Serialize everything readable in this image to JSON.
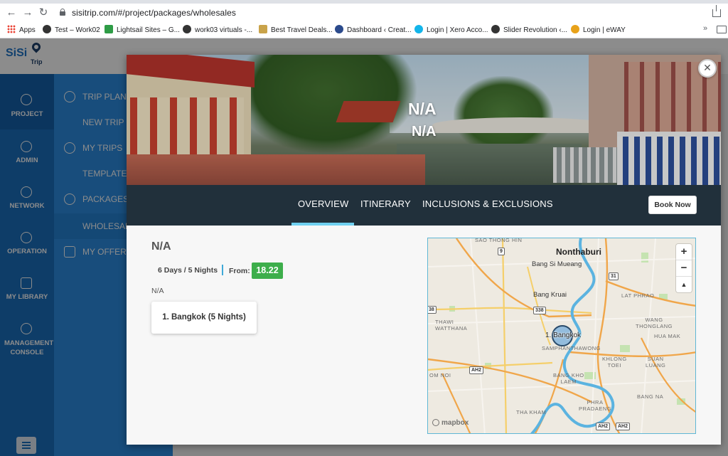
{
  "browser": {
    "url": "sisitrip.com/#/project/packages/wholesales",
    "bookmarks": [
      {
        "label": "Apps"
      },
      {
        "label": "Test – Work02"
      },
      {
        "label": "Lightsail Sites – G..."
      },
      {
        "label": "work03 virtuals -..."
      },
      {
        "label": "Best Travel Deals..."
      },
      {
        "label": "Dashboard ‹ Creat..."
      },
      {
        "label": "Login | Xero Acco..."
      },
      {
        "label": "Slider Revolution ‹..."
      },
      {
        "label": "Login | eWAY"
      }
    ],
    "more": "»"
  },
  "app": {
    "logo": "SiSi",
    "logo_sub": "Trip",
    "nav": [
      {
        "label": "PROJECT",
        "icon": "layers-icon"
      },
      {
        "label": "ADMIN",
        "icon": "user-icon"
      },
      {
        "label": "NETWORK",
        "icon": "globe-icon"
      },
      {
        "label": "OPERATION",
        "icon": "grid-icon"
      },
      {
        "label": "MY LIBRARY",
        "icon": "book-icon"
      },
      {
        "label": "MANAGEMENT CONSOLE",
        "icon": "sliders-icon"
      }
    ],
    "subnav": [
      {
        "label": "TRIP PLAN"
      },
      {
        "label": "NEW TRIP"
      },
      {
        "label": "MY TRIPS"
      },
      {
        "label": "TEMPLATE"
      },
      {
        "label": "PACKAGES"
      },
      {
        "label": "WHOLESAL"
      },
      {
        "label": "MY OFFERS"
      }
    ]
  },
  "modal": {
    "title": "N/A",
    "subtitle": "N/A",
    "tabs": [
      "OVERVIEW",
      "ITINERARY",
      "INCLUSIONS & EXCLUSIONS"
    ],
    "active_tab": "OVERVIEW",
    "book_now": "Book Now",
    "package": {
      "name": "N/A",
      "duration": "6 Days / 5 Nights",
      "from_label": "From:",
      "price": "18.22",
      "description": "N/A",
      "destinations": [
        "1. Bangkok (5 Nights)"
      ]
    },
    "map": {
      "labels": {
        "sao_thong_hin": "SAO THONG HIN",
        "nonthaburi": "Nonthaburi",
        "bang_si_mueang": "Bang Si Mueang",
        "bang_kruai": "Bang Kruai",
        "lat_phrao": "LAT PHRAO",
        "thawi_watthana": "THAWI\nWATTHANA",
        "wang_thonglang": "WANG\nTHONGLANG",
        "huai_khwang": "HUA MAK",
        "samphanthawong": "SAMPHANTHAWONG",
        "khlong_toei": "KHLONG\nTOEI",
        "suan_luang": "SUAN\nLUANG",
        "nong_khaem": "OM NOI",
        "bang_kho_laem": "BANG KHO\nLAEM",
        "bang_na": "BANG NA",
        "phra_pradaeng": "PHRA\nPRADAENG",
        "tha_kham": "THA KHAM"
      },
      "shields": [
        "9",
        "31",
        "338",
        "38",
        "AH2",
        "AH2",
        "AH2"
      ],
      "marker_label": "1. Bangkok",
      "zoom_in": "+",
      "zoom_out": "−",
      "compass": "▲",
      "attribution": "mapbox"
    }
  }
}
